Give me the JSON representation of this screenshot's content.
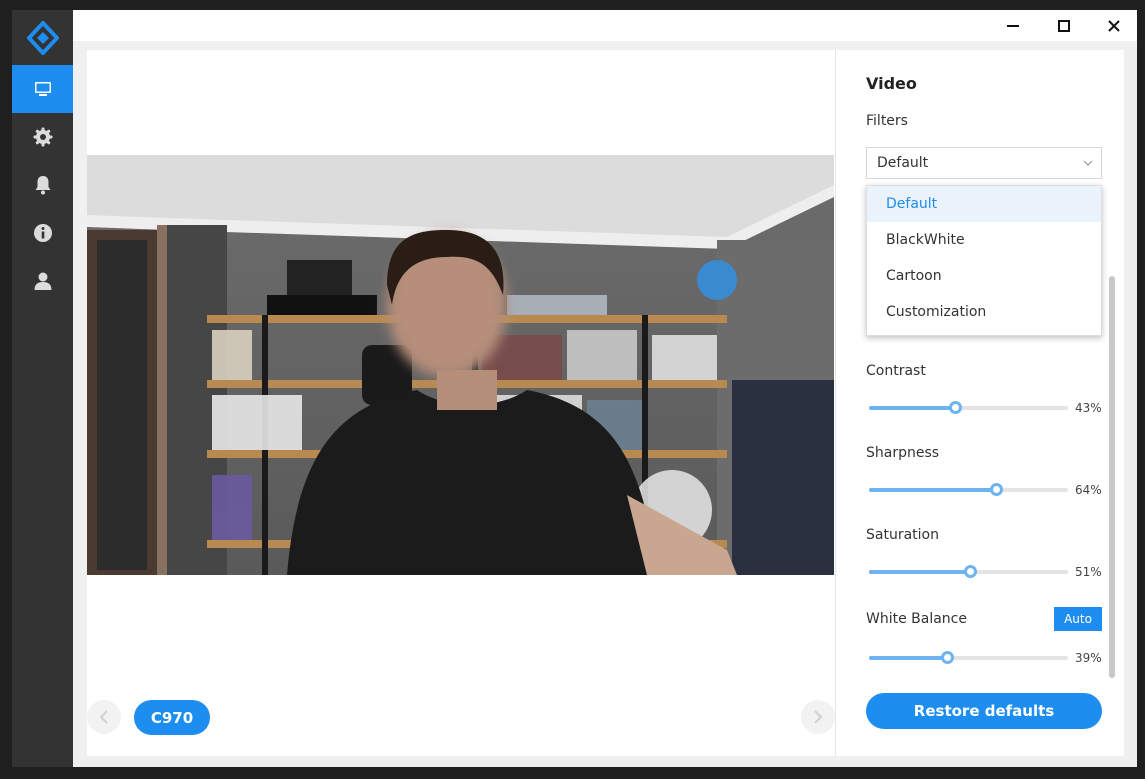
{
  "colors": {
    "accent": "#1e8df0",
    "sidebar": "#333333",
    "slider": "#6db3f0"
  },
  "sidebar": {
    "items": [
      {
        "icon": "monitor-icon",
        "active": true
      },
      {
        "icon": "gear-icon",
        "active": false
      },
      {
        "icon": "bell-icon",
        "active": false
      },
      {
        "icon": "info-icon",
        "active": false
      },
      {
        "icon": "user-icon",
        "active": false
      }
    ]
  },
  "preview": {
    "camera_label": "C970"
  },
  "panel": {
    "title": "Video",
    "filters_label": "Filters",
    "filter_selected": "Default",
    "filter_options": [
      "Default",
      "BlackWhite",
      "Cartoon",
      "Customization"
    ],
    "contrast": {
      "label": "Contrast",
      "value": 43,
      "value_text": "43%"
    },
    "sharpness": {
      "label": "Sharpness",
      "value": 64,
      "value_text": "64%"
    },
    "saturation": {
      "label": "Saturation",
      "value": 51,
      "value_text": "51%"
    },
    "white_balance": {
      "label": "White Balance",
      "auto_label": "Auto",
      "value": 39,
      "value_text": "39%"
    },
    "restore_label": "Restore defaults"
  }
}
